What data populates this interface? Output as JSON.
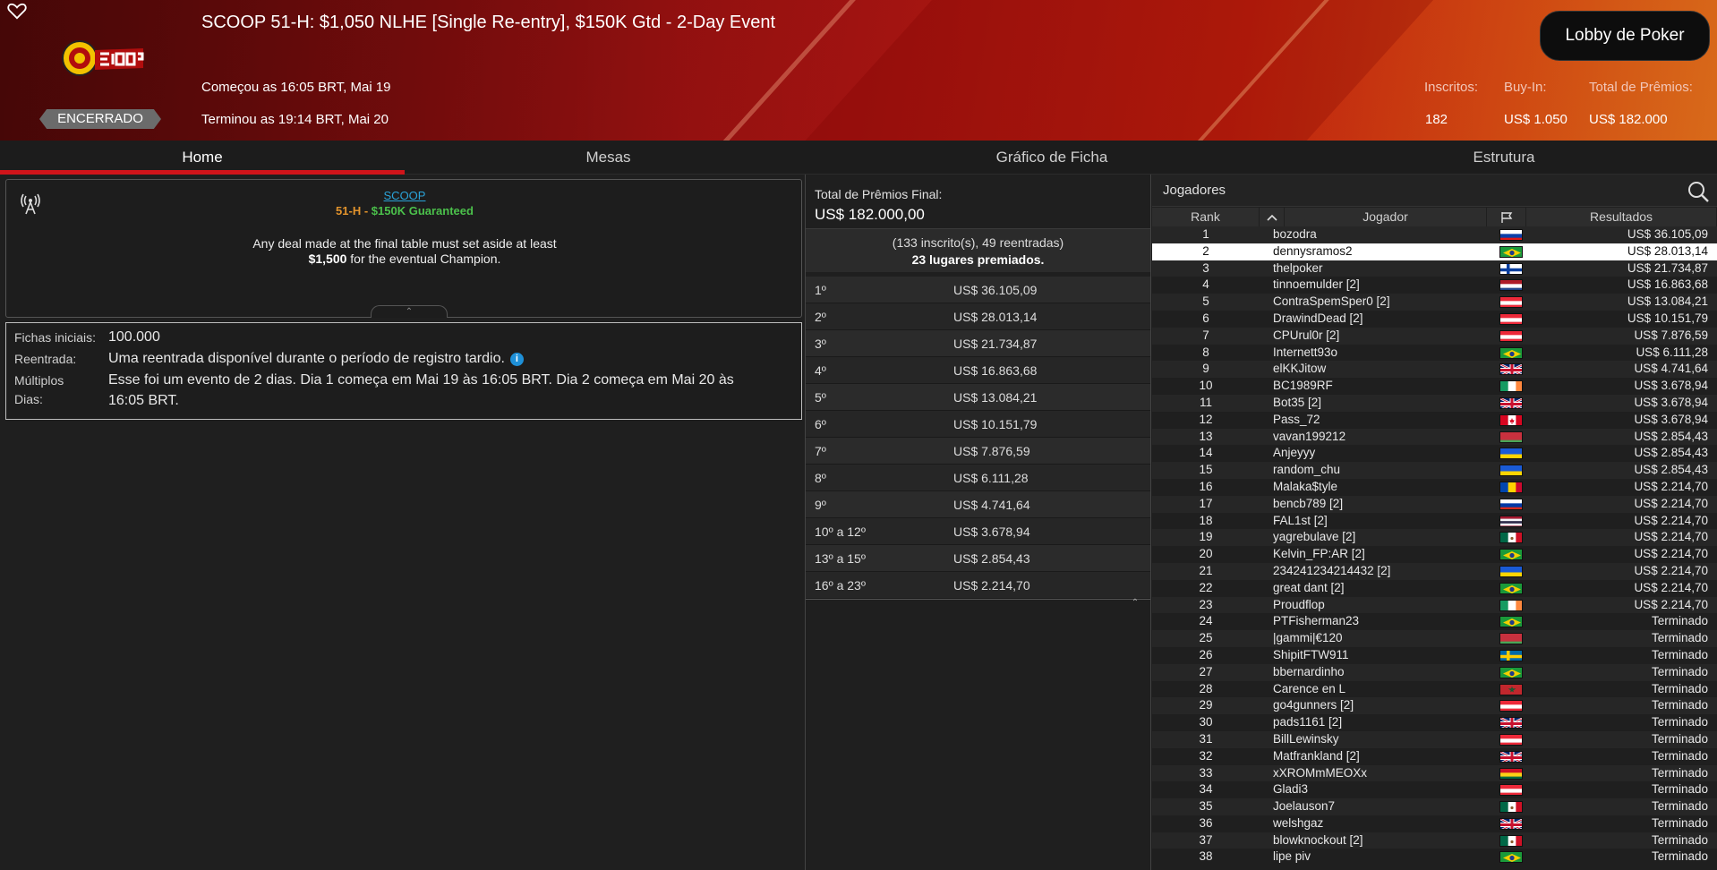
{
  "header": {
    "event_title": "SCOOP 51-H: $1,050 NLHE [Single Re-entry], $150K Gtd - 2-Day Event",
    "start_time": "Começou as 16:05 BRT, Mai 19",
    "end_time": "Terminou as 19:14 BRT, Mai 20",
    "status_badge": "ENCERRADO",
    "lobby_button": "Lobby de Poker",
    "stats": {
      "entrants_label": "Inscritos:",
      "entrants_value": "182",
      "buyin_label": "Buy-In:",
      "buyin_value": "US$ 1.050",
      "prize_label": "Total de Prêmios:",
      "prize_value": "US$ 182.000"
    }
  },
  "tabs": [
    {
      "label": "Home",
      "active": true
    },
    {
      "label": "Mesas",
      "active": false
    },
    {
      "label": "Gráfico de Ficha",
      "active": false
    },
    {
      "label": "Estrutura",
      "active": false
    }
  ],
  "info": {
    "link": "SCOOP",
    "code": "51-H",
    "separator": " - ",
    "guarantee": "$150K Guaranteed",
    "deal_text": "Any deal made at the final table must set aside at least",
    "deal_amount": "$1,500",
    "deal_suffix": " for the eventual Champion."
  },
  "details": {
    "chips_label": "Fichas iniciais:",
    "chips_value": "100.000",
    "reentry_label": "Reentrada:",
    "reentry_value": "Uma reentrada disponível durante o período de registro tardio.",
    "multi_label1": "Múltiplos",
    "multi_label2": "Dias:",
    "multi_value1": "Esse foi um evento de 2 dias. Dia 1 começa em Mai 19 às 16:05 BRT. Dia 2 começa em Mai 20 às",
    "multi_value2": "16:05 BRT."
  },
  "prize": {
    "total_label": "Total de Prêmios Final:",
    "total_value": "US$ 182.000,00",
    "entries_line": "(133 inscrito(s), 49 reentradas)",
    "places_line": "23 lugares premiados.",
    "payouts": [
      {
        "place": "1º",
        "amount": "US$ 36.105,09"
      },
      {
        "place": "2º",
        "amount": "US$ 28.013,14"
      },
      {
        "place": "3º",
        "amount": "US$ 21.734,87"
      },
      {
        "place": "4º",
        "amount": "US$ 16.863,68"
      },
      {
        "place": "5º",
        "amount": "US$ 13.084,21"
      },
      {
        "place": "6º",
        "amount": "US$ 10.151,79"
      },
      {
        "place": "7º",
        "amount": "US$ 7.876,59"
      },
      {
        "place": "8º",
        "amount": "US$ 6.111,28"
      },
      {
        "place": "9º",
        "amount": "US$ 4.741,64"
      },
      {
        "place": "10º a 12º",
        "amount": "US$ 3.678,94"
      },
      {
        "place": "13º a 15º",
        "amount": "US$ 2.854,43"
      },
      {
        "place": "16º a 23º",
        "amount": "US$ 2.214,70"
      }
    ]
  },
  "players": {
    "title": "Jogadores",
    "columns": {
      "rank": "Rank",
      "player": "Jogador",
      "results": "Resultados"
    },
    "rows": [
      {
        "rank": "1",
        "name": "bozodra",
        "flag": "si",
        "result": "US$ 36.105,09"
      },
      {
        "rank": "2",
        "name": "dennysramos2",
        "flag": "br",
        "result": "US$ 28.013,14",
        "selected": true
      },
      {
        "rank": "3",
        "name": "thelpoker",
        "flag": "fi",
        "result": "US$ 21.734,87"
      },
      {
        "rank": "4",
        "name": "tinnoemulder [2]",
        "flag": "nl",
        "result": "US$ 16.863,68"
      },
      {
        "rank": "5",
        "name": "ContraSpemSper0 [2]",
        "flag": "at",
        "result": "US$ 13.084,21"
      },
      {
        "rank": "6",
        "name": "DrawindDead [2]",
        "flag": "at",
        "result": "US$ 10.151,79"
      },
      {
        "rank": "7",
        "name": "CPUrul0r [2]",
        "flag": "at",
        "result": "US$ 7.876,59"
      },
      {
        "rank": "8",
        "name": "Internett93o",
        "flag": "br",
        "result": "US$ 6.111,28"
      },
      {
        "rank": "9",
        "name": "elKKJitow",
        "flag": "gb",
        "result": "US$ 4.741,64"
      },
      {
        "rank": "10",
        "name": "BC1989RF",
        "flag": "ie",
        "result": "US$ 3.678,94"
      },
      {
        "rank": "11",
        "name": "Bot35 [2]",
        "flag": "gb",
        "result": "US$ 3.678,94"
      },
      {
        "rank": "12",
        "name": "Pass_72",
        "flag": "ca",
        "result": "US$ 3.678,94"
      },
      {
        "rank": "13",
        "name": "vavan199212",
        "flag": "by",
        "result": "US$ 2.854,43"
      },
      {
        "rank": "14",
        "name": "Anjeyyy",
        "flag": "ua",
        "result": "US$ 2.854,43"
      },
      {
        "rank": "15",
        "name": "random_chu",
        "flag": "ua",
        "result": "US$ 2.854,43"
      },
      {
        "rank": "16",
        "name": "Malaka$tyle",
        "flag": "md",
        "result": "US$ 2.214,70"
      },
      {
        "rank": "17",
        "name": "bencb789 [2]",
        "flag": "ru",
        "result": "US$ 2.214,70"
      },
      {
        "rank": "18",
        "name": "FAL1st [2]",
        "flag": "th",
        "result": "US$ 2.214,70"
      },
      {
        "rank": "19",
        "name": "yagrebulave [2]",
        "flag": "mx",
        "result": "US$ 2.214,70"
      },
      {
        "rank": "20",
        "name": "Kelvin_FP:AR [2]",
        "flag": "br",
        "result": "US$ 2.214,70"
      },
      {
        "rank": "21",
        "name": "234241234214432 [2]",
        "flag": "ua",
        "result": "US$ 2.214,70"
      },
      {
        "rank": "22",
        "name": "great dant [2]",
        "flag": "br",
        "result": "US$ 2.214,70"
      },
      {
        "rank": "23",
        "name": "Proudflop",
        "flag": "ie",
        "result": "US$ 2.214,70"
      },
      {
        "rank": "24",
        "name": "PTFisherman23",
        "flag": "br",
        "result": "Terminado"
      },
      {
        "rank": "25",
        "name": "|gammi|€120",
        "flag": "by",
        "result": "Terminado"
      },
      {
        "rank": "26",
        "name": "ShipitFTW911",
        "flag": "se",
        "result": "Terminado"
      },
      {
        "rank": "27",
        "name": "bbernardinho",
        "flag": "br",
        "result": "Terminado"
      },
      {
        "rank": "28",
        "name": "Carence en L",
        "flag": "ma",
        "result": "Terminado"
      },
      {
        "rank": "29",
        "name": "go4gunners [2]",
        "flag": "at",
        "result": "Terminado"
      },
      {
        "rank": "30",
        "name": "pads1161 [2]",
        "flag": "gb",
        "result": "Terminado"
      },
      {
        "rank": "31",
        "name": "BillLewinsky",
        "flag": "at",
        "result": "Terminado"
      },
      {
        "rank": "32",
        "name": "Matfrankland [2]",
        "flag": "gb",
        "result": "Terminado"
      },
      {
        "rank": "33",
        "name": "xXROMmMEOXx",
        "flag": "gh",
        "result": "Terminado"
      },
      {
        "rank": "34",
        "name": "Gladi3",
        "flag": "at",
        "result": "Terminado"
      },
      {
        "rank": "35",
        "name": "Joelauson7",
        "flag": "mx",
        "result": "Terminado"
      },
      {
        "rank": "36",
        "name": "welshgaz",
        "flag": "gb",
        "result": "Terminado"
      },
      {
        "rank": "37",
        "name": "blowknockout [2]",
        "flag": "mx",
        "result": "Terminado"
      },
      {
        "rank": "38",
        "name": "lipe piv",
        "flag": "br",
        "result": "Terminado"
      }
    ]
  },
  "colors": {
    "accent_red": "#d0141a",
    "link_blue": "#2aa3d8",
    "code_orange": "#e2932c",
    "guarantee_green": "#4bc04b",
    "selected_row": "#ffffff"
  },
  "icons": {
    "heart": "heart-icon",
    "antenna": "antenna-icon",
    "search": "search-icon",
    "flag": "flag-icon",
    "sort": "chevron-up-icon"
  }
}
